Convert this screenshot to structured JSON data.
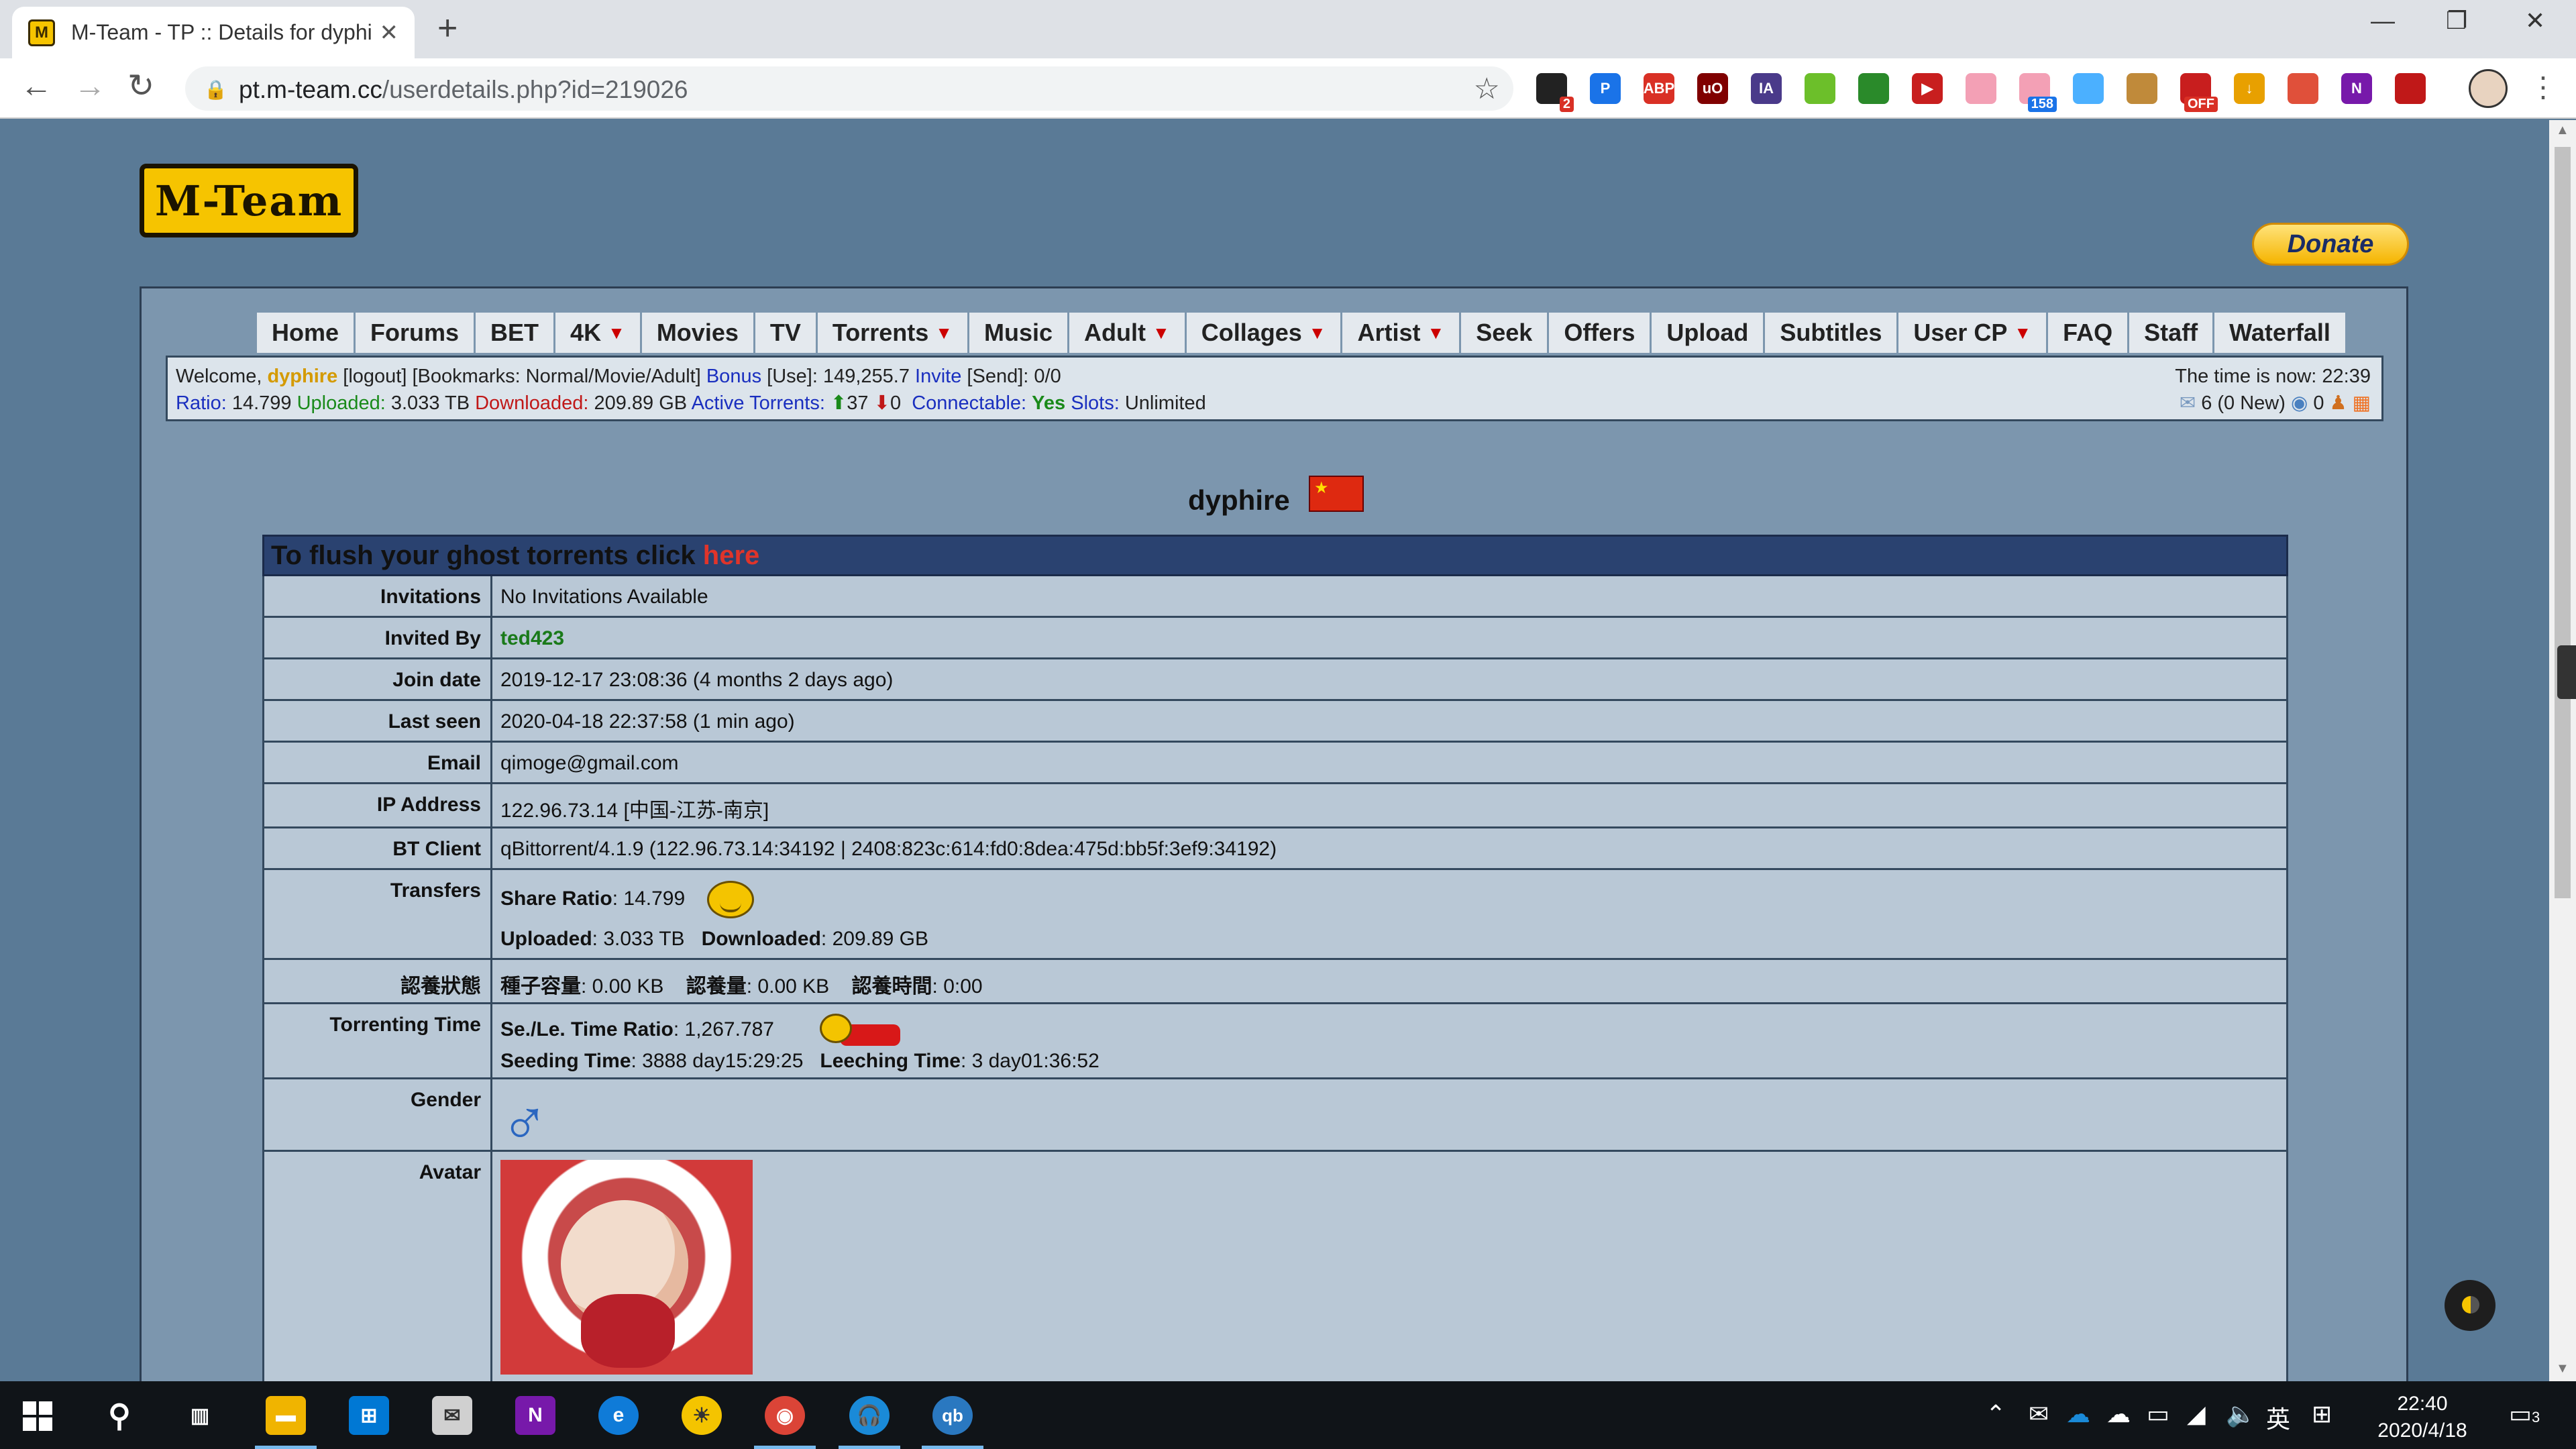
{
  "browser": {
    "tab_title": "M-Team - TP :: Details for dyphire",
    "tab_favicon_letter": "M",
    "new_tab": "+",
    "url_host": "pt.m-team.cc",
    "url_path": "/userdetails.php?id=219026",
    "extensions": [
      {
        "name": "extension-cam-icon",
        "color": "#222222",
        "label": "",
        "badge": "2"
      },
      {
        "name": "extension-p-icon",
        "color": "#1a73e8",
        "label": "P",
        "badge": ""
      },
      {
        "name": "extension-abp-icon",
        "color": "#d93025",
        "label": "ABP",
        "badge": ""
      },
      {
        "name": "extension-ublock-icon",
        "color": "#800000",
        "label": "uO",
        "badge": ""
      },
      {
        "name": "extension-ia-icon",
        "color": "#4a3a8a",
        "label": "IA",
        "badge": ""
      },
      {
        "name": "extension-face-icon",
        "color": "#6cbf2a",
        "label": "",
        "badge": ""
      },
      {
        "name": "extension-globe-icon",
        "color": "#2a8a2a",
        "label": "",
        "badge": ""
      },
      {
        "name": "extension-play-icon",
        "color": "#c81e1e",
        "label": "▶",
        "badge": ""
      },
      {
        "name": "extension-bilibili-icon",
        "color": "#f3a0b5",
        "label": "",
        "badge": ""
      },
      {
        "name": "extension-tv-icon",
        "color": "#f3a0b5",
        "label": "",
        "badge": "158"
      },
      {
        "name": "extension-pen-icon",
        "color": "#4bb0ff",
        "label": "",
        "badge": ""
      },
      {
        "name": "extension-cookie-icon",
        "color": "#c08a3a",
        "label": "",
        "badge": ""
      },
      {
        "name": "extension-gift-icon",
        "color": "#c81e1e",
        "label": "",
        "badge": "OFF"
      },
      {
        "name": "extension-download-icon",
        "color": "#e8a000",
        "label": "↓",
        "badge": ""
      },
      {
        "name": "extension-color-icon",
        "color": "#e0503a",
        "label": "",
        "badge": ""
      },
      {
        "name": "extension-onenote-icon",
        "color": "#7719aa",
        "label": "N",
        "badge": ""
      },
      {
        "name": "extension-red-icon",
        "color": "#c01818",
        "label": "",
        "badge": ""
      }
    ]
  },
  "site": {
    "logo_text": "M-Team",
    "donate_label": "Donate",
    "menu": [
      {
        "name": "menu-home",
        "label": "Home",
        "caret": false
      },
      {
        "name": "menu-forums",
        "label": "Forums",
        "caret": false
      },
      {
        "name": "menu-bet",
        "label": "BET",
        "caret": false
      },
      {
        "name": "menu-4k",
        "label": "4K",
        "caret": true
      },
      {
        "name": "menu-movies",
        "label": "Movies",
        "caret": false
      },
      {
        "name": "menu-tv",
        "label": "TV",
        "caret": false
      },
      {
        "name": "menu-torrents",
        "label": "Torrents",
        "caret": true
      },
      {
        "name": "menu-music",
        "label": "Music",
        "caret": false
      },
      {
        "name": "menu-adult",
        "label": "Adult",
        "caret": true
      },
      {
        "name": "menu-collages",
        "label": "Collages",
        "caret": true
      },
      {
        "name": "menu-artist",
        "label": "Artist",
        "caret": true
      },
      {
        "name": "menu-seek",
        "label": "Seek",
        "caret": false
      },
      {
        "name": "menu-offers",
        "label": "Offers",
        "caret": false
      },
      {
        "name": "menu-upload",
        "label": "Upload",
        "caret": false
      },
      {
        "name": "menu-subtitles",
        "label": "Subtitles",
        "caret": false
      },
      {
        "name": "menu-user-cp",
        "label": "User CP",
        "caret": true
      },
      {
        "name": "menu-faq",
        "label": "FAQ",
        "caret": false
      },
      {
        "name": "menu-staff",
        "label": "Staff",
        "caret": false
      },
      {
        "name": "menu-waterfall",
        "label": "Waterfall",
        "caret": false
      }
    ],
    "info": {
      "welcome": "Welcome,",
      "username": "dyphire",
      "logout": "[logout]",
      "bookmarks": "[Bookmarks:  Normal/Movie/Adult]",
      "bonus_label": "Bonus",
      "bonus_use": "[Use]: 149,255.7",
      "invite_label": "Invite",
      "invite_send": "[Send]: 0/0",
      "ratio_label": "Ratio:",
      "ratio": "14.799",
      "uploaded_label": "Uploaded:",
      "uploaded": "3.033 TB",
      "downloaded_label": "Downloaded:",
      "downloaded": "209.89 GB",
      "active_label": "Active Torrents:",
      "active_seed": "37",
      "active_leech": "0",
      "connectable_label": "Connectable:",
      "connectable": "Yes",
      "slots_label": "Slots:",
      "slots": "Unlimited",
      "time": "The time is now: 22:39",
      "messages": "6 (0 New)",
      "friends": "0"
    }
  },
  "profile": {
    "username": "dyphire",
    "ghost_text": "To flush your ghost torrents click",
    "ghost_link": "here",
    "invitations_label": "Invitations",
    "invitations": "No Invitations Available",
    "invited_by_label": "Invited By",
    "invited_by": "ted423",
    "join_label": "Join date",
    "join": "2019-12-17 23:08:36 (4 months 2 days ago)",
    "seen_label": "Last seen",
    "seen": "2020-04-18 22:37:58 (1 min ago)",
    "email_label": "Email",
    "email": "qimoge@gmail.com",
    "ip_label": "IP Address",
    "ip": "122.96.73.14 [中国-江苏-南京]",
    "client_label": "BT Client",
    "client": "qBittorrent/4.1.9 (122.96.73.14:34192 | 2408:823c:614:fd0:8dea:475d:bb5f:3ef9:34192)",
    "transfers_label": "Transfers",
    "share_ratio_label": "Share Ratio",
    "share_ratio": ": 14.799",
    "uploaded_label": "Uploaded",
    "uploaded": ": 3.033 TB",
    "downloaded_label": "Downloaded",
    "downloaded": ": 209.89 GB",
    "adopt_label": "認養狀態",
    "seed_cap_label": "種子容量",
    "seed_cap": ": 0.00 KB",
    "adopt_amt_label": "認養量",
    "adopt_amt": ": 0.00 KB",
    "adopt_time_label": "認養時間",
    "adopt_time": ": 0:00",
    "torrenting_label": "Torrenting Time",
    "se_le_label": "Se./Le. Time Ratio",
    "se_le": ": 1,267.787",
    "seeding_label": "Seeding Time",
    "seeding": ": 3888 day15:29:25",
    "leeching_label": "Leeching Time",
    "leeching": ": 3 day01:36:52",
    "gender_label": "Gender",
    "gender_symbol": "♂",
    "avatar_label": "Avatar"
  },
  "taskbar": {
    "clock_time": "22:40",
    "clock_date": "2020/4/18",
    "ime": "英",
    "notifications": "3"
  }
}
